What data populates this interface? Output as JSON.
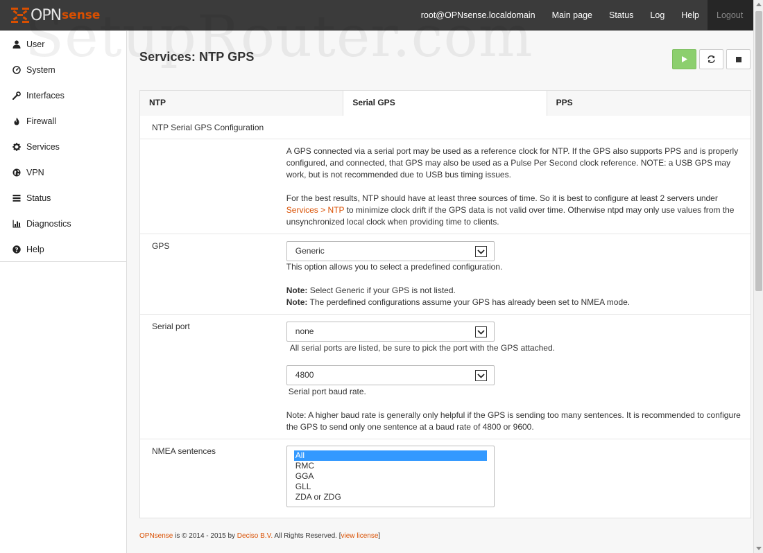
{
  "brand": {
    "opn": "OPN",
    "sense": "sense",
    "accent_color": "#d94f00"
  },
  "watermark": "SetupRouter.com",
  "nav": {
    "user": "root@OPNsense.localdomain",
    "items": [
      "Main page",
      "Status",
      "Log",
      "Help"
    ],
    "logout": "Logout"
  },
  "sidebar": {
    "items": [
      {
        "label": "User",
        "icon": "user-icon"
      },
      {
        "label": "System",
        "icon": "dashboard-icon"
      },
      {
        "label": "Interfaces",
        "icon": "wrench-icon"
      },
      {
        "label": "Firewall",
        "icon": "fire-icon"
      },
      {
        "label": "Services",
        "icon": "cog-icon"
      },
      {
        "label": "VPN",
        "icon": "globe-icon"
      },
      {
        "label": "Status",
        "icon": "tasks-icon"
      },
      {
        "label": "Diagnostics",
        "icon": "bar-chart-icon"
      },
      {
        "label": "Help",
        "icon": "question-circle-icon"
      }
    ]
  },
  "page": {
    "title": "Services: NTP GPS",
    "buttons": [
      "play-icon",
      "refresh-icon",
      "stop-icon"
    ]
  },
  "tabs": [
    {
      "label": "NTP",
      "active": false
    },
    {
      "label": "Serial GPS",
      "active": true
    },
    {
      "label": "PPS",
      "active": false
    }
  ],
  "section": {
    "heading": "NTP Serial GPS Configuration",
    "intro1": "A GPS connected via a serial port may be used as a reference clock for NTP. If the GPS also supports PPS and is properly configured, and connected, that GPS may also be used as a Pulse Per Second clock reference. NOTE: a USB GPS may work, but is not recommended due to USB bus timing issues.",
    "intro2_a": "For the best results, NTP should have at least three sources of time. So it is best to configure at least 2 servers under ",
    "intro2_link": "Services > NTP",
    "intro2_b": " to minimize clock drift if the GPS data is not valid over time. Otherwise ntpd may only use values from the unsynchronized local clock when providing time to clients."
  },
  "gps": {
    "label": "GPS",
    "selected": "Generic",
    "help": "This option allows you to select a predefined configuration.",
    "note_label": "Note:",
    "note1": " Select Generic if your GPS is not listed.",
    "note2": " The perdefined configurations assume your GPS has already been set to NMEA mode."
  },
  "serial": {
    "label": "Serial port",
    "port_selected": "none",
    "port_help": "All serial ports are listed, be sure to pick the port with the GPS attached.",
    "baud_selected": "4800",
    "baud_help": "Serial port baud rate.",
    "note": "Note: A higher baud rate is generally only helpful if the GPS is sending too many sentences. It is recommended to configure the GPS to send only one sentence at a baud rate of 4800 or 9600."
  },
  "nmea": {
    "label": "NMEA sentences",
    "options": [
      "All",
      "RMC",
      "GGA",
      "GLL",
      "ZDA or ZDG"
    ],
    "selected": "All"
  },
  "footer": {
    "brand": "OPNsense",
    "text1": " is © 2014 - 2015 by ",
    "company": "Deciso B.V.",
    "text2": " All Rights Reserved. [",
    "license": "view license",
    "text3": "]"
  }
}
